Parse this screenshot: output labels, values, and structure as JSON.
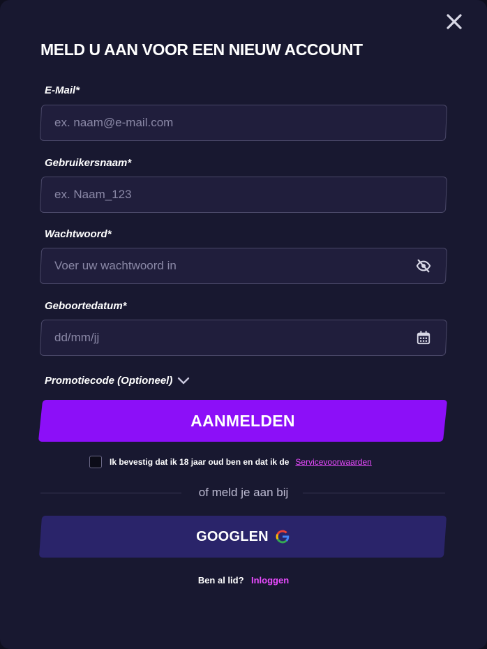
{
  "modal": {
    "title": "MELD U AAN VOOR EEN NIEUW ACCOUNT",
    "close_icon": "close-icon"
  },
  "form": {
    "email": {
      "label": "E-Mail*",
      "placeholder": "ex. naam@e-mail.com",
      "value": ""
    },
    "username": {
      "label": "Gebruikersnaam*",
      "placeholder": "ex. Naam_123",
      "value": ""
    },
    "password": {
      "label": "Wachtwoord*",
      "placeholder": "Voer uw wachtwoord in",
      "value": "",
      "toggle_icon": "eye-off-icon"
    },
    "birthdate": {
      "label": "Geboortedatum*",
      "placeholder": "dd/mm/jj",
      "value": "",
      "icon": "calendar-icon"
    },
    "promo": {
      "label": "Promotiecode (Optioneel)",
      "icon": "chevron-down-icon"
    },
    "submit_label": "AANMELDEN",
    "confirm": {
      "checked": false,
      "text": "Ik bevestig dat ik 18 jaar oud ben en dat ik de",
      "link": "Servicevoorwaarden"
    }
  },
  "social": {
    "divider_text": "of meld je aan bij",
    "google_label": "GOOGLEN",
    "google_icon": "google-icon"
  },
  "footer": {
    "question": "Ben al lid?",
    "login_link": "Inloggen"
  },
  "colors": {
    "background": "#181830",
    "input_bg": "#201e3c",
    "primary": "#8c0ff8",
    "google_button": "#2a246a",
    "link": "#e94bff"
  }
}
